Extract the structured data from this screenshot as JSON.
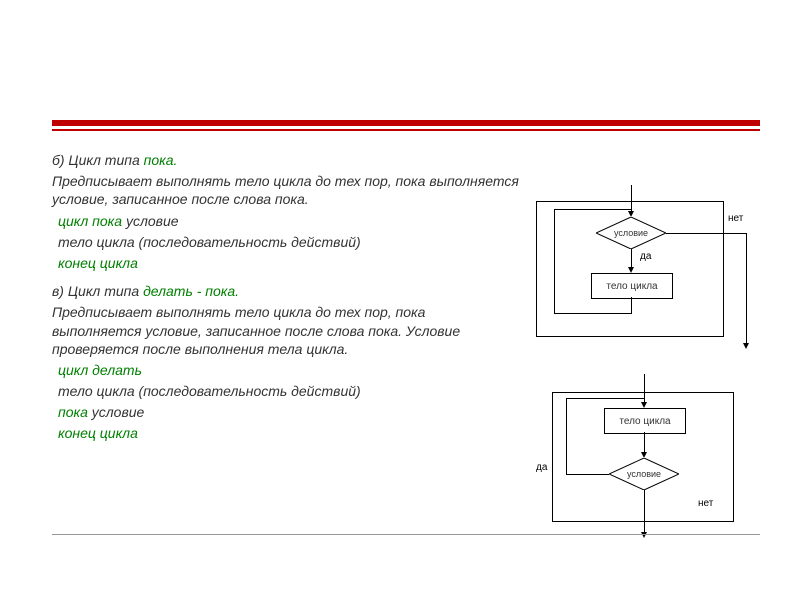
{
  "section_b": {
    "heading_prefix": "б) Цикл типа ",
    "heading_keyword": "пока.",
    "description": "Предписывает выполнять тело цикла до тех пор, пока выполняется условие, записанное после слова пока.",
    "code": {
      "l1_kw": "цикл пока",
      "l1_rest": " условие",
      "l2": "тело цикла (последовательность действий)",
      "l3": "конец цикла"
    }
  },
  "section_v": {
    "heading_prefix": "в) Цикл типа ",
    "heading_keyword": "делать - пока.",
    "description": "Предписывает выполнять тело цикла до тех пор, пока выполняется условие, записанное после слова пока. Условие проверяется после выполнения тела цикла.",
    "code": {
      "l1": "цикл делать",
      "l2": "тело цикла (последовательность действий)",
      "l3_kw": "пока",
      "l3_rest": " условие",
      "l4": "конец цикла"
    }
  },
  "flowchart": {
    "condition": "условие",
    "body": "тело цикла",
    "yes": "да",
    "no": "нет"
  }
}
